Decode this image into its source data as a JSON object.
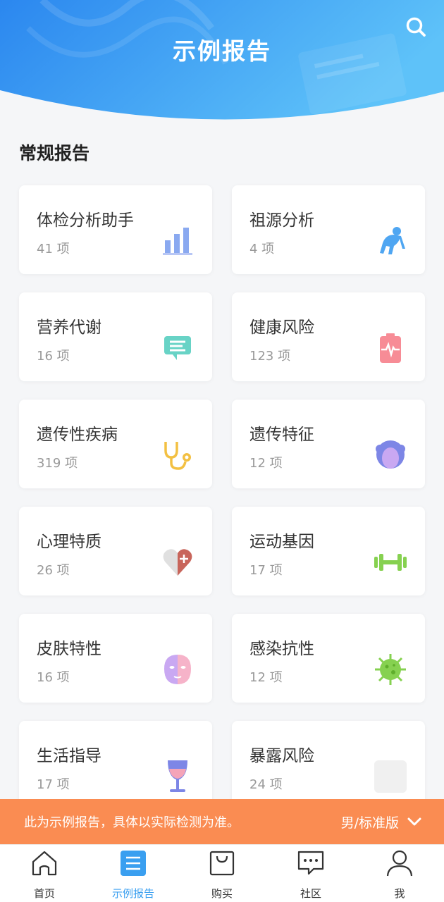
{
  "header": {
    "title": "示例报告",
    "search_icon": "search-icon",
    "gradient": [
      "#2c8df0",
      "#5bc0f8"
    ]
  },
  "section": {
    "title": "常规报告"
  },
  "cards": [
    {
      "title": "体检分析助手",
      "count": "41 项",
      "icon": "bar-chart-icon"
    },
    {
      "title": "祖源分析",
      "count": "4 项",
      "icon": "ape-icon"
    },
    {
      "title": "营养代谢",
      "count": "16 项",
      "icon": "chat-bubble-icon"
    },
    {
      "title": "健康风险",
      "count": "123 项",
      "icon": "heartbeat-battery-icon"
    },
    {
      "title": "遗传性疾病",
      "count": "319 项",
      "icon": "stethoscope-icon"
    },
    {
      "title": "遗传特征",
      "count": "12 项",
      "icon": "curly-hair-face-icon"
    },
    {
      "title": "心理特质",
      "count": "26 项",
      "icon": "heart-plus-icon"
    },
    {
      "title": "运动基因",
      "count": "17 项",
      "icon": "dumbbell-icon"
    },
    {
      "title": "皮肤特性",
      "count": "16 项",
      "icon": "face-mask-icon"
    },
    {
      "title": "感染抗性",
      "count": "12 项",
      "icon": "virus-icon"
    },
    {
      "title": "生活指导",
      "count": "17 项",
      "icon": "wine-glass-icon"
    },
    {
      "title": "暴露风险",
      "count": "24 项",
      "icon": "placeholder-icon"
    }
  ],
  "notice": {
    "text": "此为示例报告，具体以实际检测为准。",
    "version": "男/标准版",
    "chevron_icon": "chevron-down-icon",
    "color": "#fa8c52"
  },
  "tabs": [
    {
      "label": "首页",
      "icon": "home-icon",
      "active": false
    },
    {
      "label": "示例报告",
      "icon": "report-list-icon",
      "active": true
    },
    {
      "label": "购买",
      "icon": "shopping-bag-icon",
      "active": false
    },
    {
      "label": "社区",
      "icon": "message-icon",
      "active": false
    },
    {
      "label": "我",
      "icon": "user-icon",
      "active": false
    }
  ],
  "accent_color": "#3a9ff0"
}
